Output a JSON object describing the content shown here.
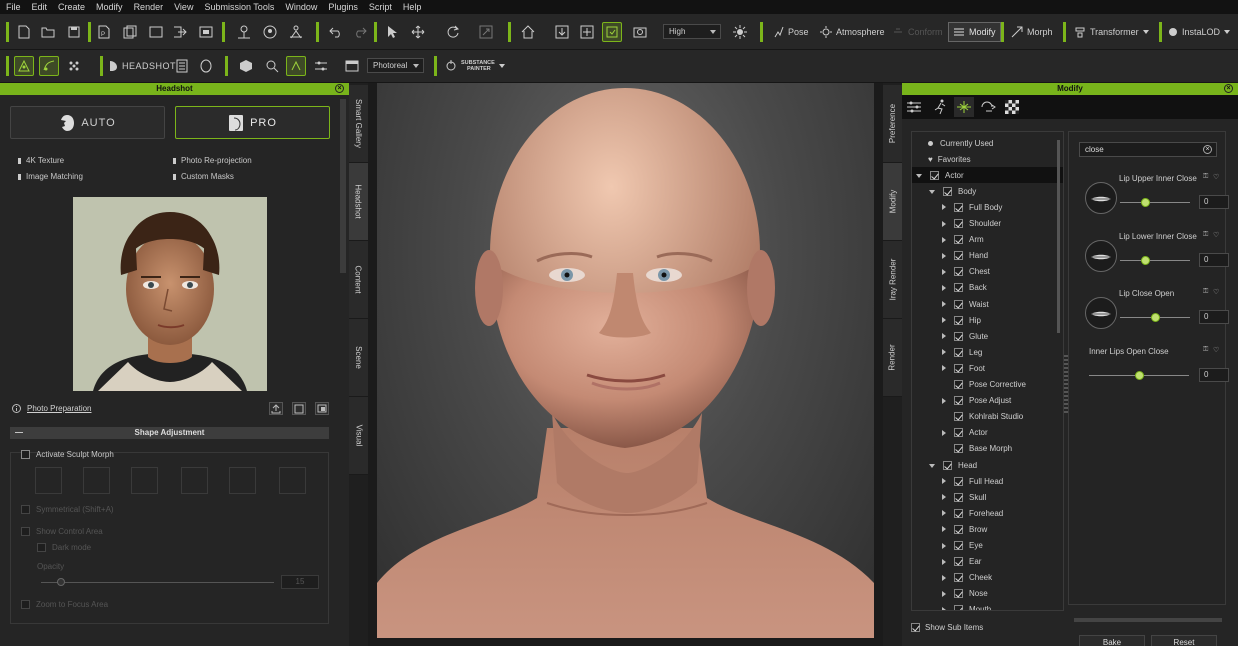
{
  "menu": [
    "File",
    "Edit",
    "Create",
    "Modify",
    "Render",
    "View",
    "Submission Tools",
    "Window",
    "Plugins",
    "Script",
    "Help"
  ],
  "toolbar1": {
    "quality": "High",
    "pose": "Pose",
    "atmosphere": "Atmosphere",
    "conform": "Conform",
    "modify": "Modify",
    "morph": "Morph",
    "transformer": "Transformer",
    "instalod": "InstaLOD"
  },
  "toolbar2": {
    "headshot": "HEADSHOT",
    "render_mode": "Photoreal",
    "substance_line1": "SUBSTANCE",
    "substance_line2": "PAINTER"
  },
  "headshot_panel": {
    "title": "Headshot",
    "auto_label": "AUTO",
    "pro_label": "PRO",
    "features": [
      "4K Texture",
      "Photo Re-projection",
      "Image Matching",
      "Custom Masks"
    ],
    "photo_prep": "Photo Preparation",
    "shape_adjustment": "Shape Adjustment",
    "activate_sculpt": "Activate Sculpt Morph",
    "symmetrical": "Symmetrical (Shift+A)",
    "show_control_area": "Show Control Area",
    "dark_mode": "Dark mode",
    "opacity": "Opacity",
    "opacity_value": "15",
    "zoom_focus": "Zoom to Focus Area"
  },
  "left_tabs": [
    "Smart Gallery",
    "Headshot",
    "Content",
    "Scene",
    "Visual"
  ],
  "right_tabs": [
    "Preference",
    "Modify",
    "Iray Render",
    "Render"
  ],
  "modify_panel": {
    "title": "Modify",
    "tree": [
      {
        "label": "Currently Used",
        "kind": "dot",
        "level": 0
      },
      {
        "label": "Favorites",
        "kind": "heart",
        "level": 0
      },
      {
        "label": "Actor",
        "kind": "open",
        "level": 0,
        "selected": true
      },
      {
        "label": "Body",
        "kind": "open",
        "level": 1
      },
      {
        "label": "Full Body",
        "kind": "closed",
        "level": 2
      },
      {
        "label": "Shoulder",
        "kind": "closed",
        "level": 2
      },
      {
        "label": "Arm",
        "kind": "closed",
        "level": 2
      },
      {
        "label": "Hand",
        "kind": "closed",
        "level": 2
      },
      {
        "label": "Chest",
        "kind": "closed",
        "level": 2
      },
      {
        "label": "Back",
        "kind": "closed",
        "level": 2
      },
      {
        "label": "Waist",
        "kind": "closed",
        "level": 2
      },
      {
        "label": "Hip",
        "kind": "closed",
        "level": 2
      },
      {
        "label": "Glute",
        "kind": "closed",
        "level": 2
      },
      {
        "label": "Leg",
        "kind": "closed",
        "level": 2
      },
      {
        "label": "Foot",
        "kind": "closed",
        "level": 2
      },
      {
        "label": "Pose Corrective",
        "kind": "leaf",
        "level": 2
      },
      {
        "label": "Pose Adjust",
        "kind": "closed",
        "level": 2
      },
      {
        "label": "Kohlrabi Studio",
        "kind": "leaf",
        "level": 2
      },
      {
        "label": "Actor",
        "kind": "closed",
        "level": 2
      },
      {
        "label": "Base Morph",
        "kind": "leaf",
        "level": 2
      },
      {
        "label": "Head",
        "kind": "open",
        "level": 1
      },
      {
        "label": "Full Head",
        "kind": "closed",
        "level": 2
      },
      {
        "label": "Skull",
        "kind": "closed",
        "level": 2
      },
      {
        "label": "Forehead",
        "kind": "closed",
        "level": 2
      },
      {
        "label": "Brow",
        "kind": "closed",
        "level": 2
      },
      {
        "label": "Eye",
        "kind": "closed",
        "level": 2
      },
      {
        "label": "Ear",
        "kind": "closed",
        "level": 2
      },
      {
        "label": "Cheek",
        "kind": "closed",
        "level": 2
      },
      {
        "label": "Nose",
        "kind": "closed",
        "level": 2
      },
      {
        "label": "Mouth",
        "kind": "closed",
        "level": 2
      }
    ],
    "search": "close",
    "sliders": [
      {
        "label": "Lip Upper Inner Close",
        "value": "0",
        "level": 0.35,
        "thumb": true
      },
      {
        "label": "Lip Lower Inner Close",
        "value": "0",
        "level": 0.35,
        "thumb": true
      },
      {
        "label": "Lip Close Open",
        "value": "0",
        "level": 0.5,
        "thumb": true
      },
      {
        "label": "Inner Lips Open Close",
        "value": "0",
        "level": 0.5,
        "thumb": false
      }
    ],
    "bake": "Bake",
    "reset": "Reset",
    "show_sub_items": "Show Sub Items"
  }
}
